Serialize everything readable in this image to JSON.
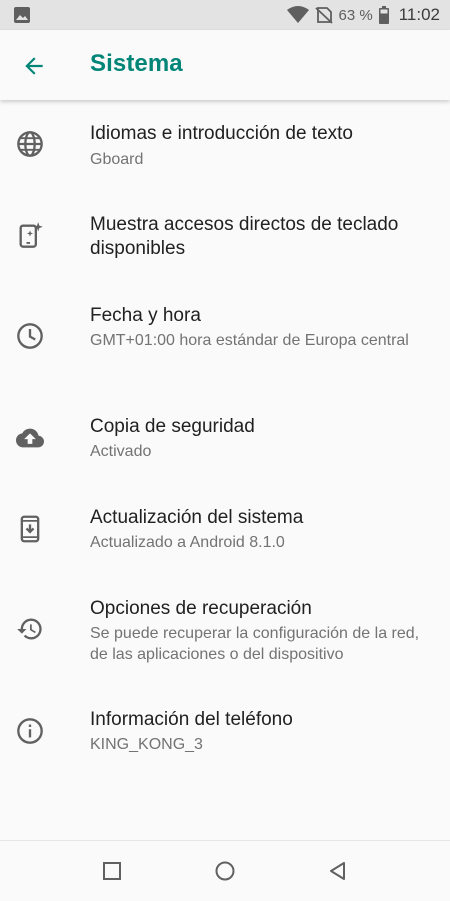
{
  "status_bar": {
    "battery_percent": "63 %",
    "time": "11:02",
    "icons": [
      "image-notification-icon",
      "wifi-icon",
      "no-signal-icon",
      "battery-icon"
    ]
  },
  "header": {
    "title": "Sistema",
    "back_icon": "arrow-back-icon"
  },
  "items": [
    {
      "icon": "globe-icon",
      "title": "Idiomas e introducción de texto",
      "subtitle": "Gboard"
    },
    {
      "icon": "keyboard-shortcuts-icon",
      "title": "Muestra accesos directos de teclado disponibles",
      "subtitle": ""
    },
    {
      "icon": "clock-icon",
      "title": "Fecha y hora",
      "subtitle": "GMT+01:00 hora estándar de Europa central"
    },
    {
      "icon": "cloud-upload-icon",
      "title": "Copia de seguridad",
      "subtitle": "Activado"
    },
    {
      "icon": "system-update-icon",
      "title": "Actualización del sistema",
      "subtitle": "Actualizado a Android 8.1.0"
    },
    {
      "icon": "restore-icon",
      "title": "Opciones de recuperación",
      "subtitle": "Se puede recuperar la configuración de la red, de las aplicaciones o del dispositivo"
    },
    {
      "icon": "info-icon",
      "title": "Información del teléfono",
      "subtitle": "KING_KONG_3"
    }
  ],
  "nav_bar": {
    "icons": [
      "recents-icon",
      "home-icon",
      "back-icon"
    ]
  },
  "colors": {
    "accent": "#008577",
    "status_bar": "#e3e3e3",
    "background": "#fafafa",
    "icon": "#616161",
    "title_text": "#212121",
    "subtitle_text": "#737373"
  }
}
